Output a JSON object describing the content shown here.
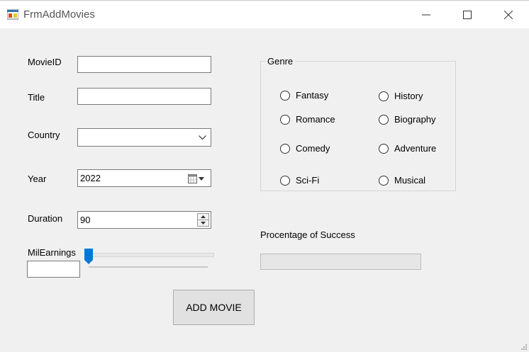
{
  "window": {
    "title": "FrmAddMovies"
  },
  "form": {
    "movieid_label": "MovieID",
    "movieid_value": "",
    "title_label": "Title",
    "title_value": "",
    "country_label": "Country",
    "country_value": "",
    "year_label": "Year",
    "year_value": "2022",
    "duration_label": "Duration",
    "duration_value": "90",
    "milearnings_label": "MilEarnings",
    "milearnings_value": "",
    "milearnings_slider_fraction": 0.0
  },
  "genre": {
    "title": "Genre",
    "options": [
      "Fantasy",
      "History",
      "Romance",
      "Biography",
      "Comedy",
      "Adventure",
      "Sci-Fi",
      "Musical"
    ]
  },
  "success": {
    "label": "Procentage of Success",
    "progress_fraction": 0.0
  },
  "actions": {
    "add_label": "ADD MOVIE"
  },
  "icons": {
    "app": "form-icon",
    "minimize": "minimize-icon",
    "maximize": "maximize-icon",
    "close": "close-icon",
    "dropdown": "chevron-down-icon",
    "calendar": "calendar-icon",
    "spinner": "spinner-arrows-icon",
    "resize": "resize-grip-icon"
  },
  "colors": {
    "accent": "#0078d7",
    "progress": "#06b025"
  }
}
